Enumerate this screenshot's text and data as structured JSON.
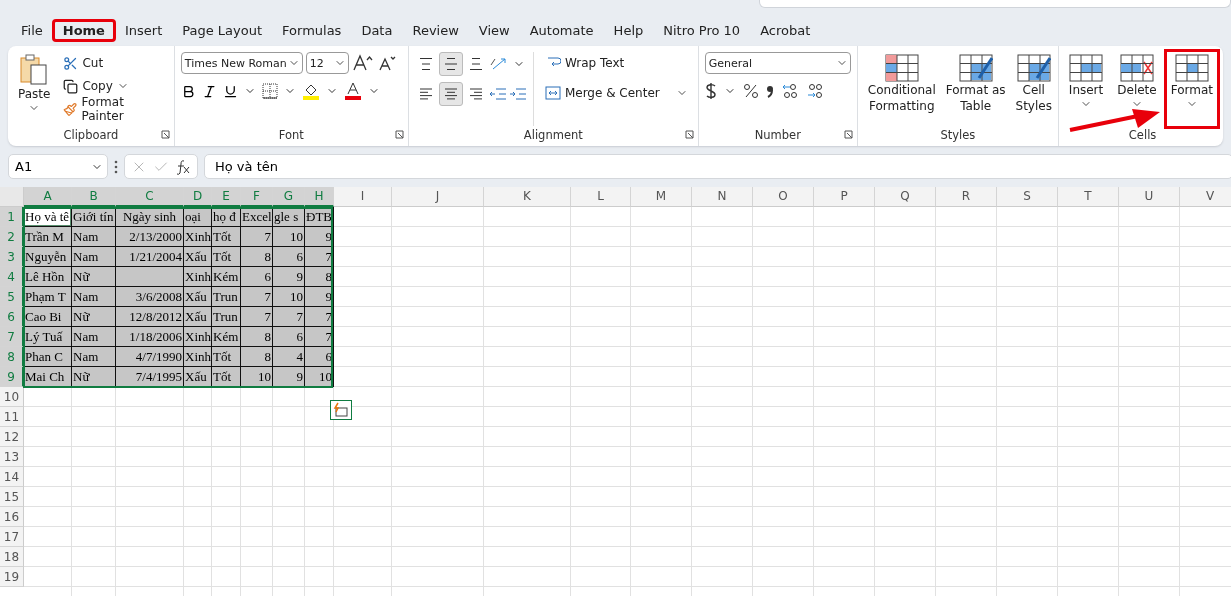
{
  "menu_tabs": [
    {
      "label": "File",
      "selected": false,
      "highlighted": false
    },
    {
      "label": "Home",
      "selected": true,
      "highlighted": true
    },
    {
      "label": "Insert",
      "selected": false,
      "highlighted": false
    },
    {
      "label": "Page Layout",
      "selected": false,
      "highlighted": false
    },
    {
      "label": "Formulas",
      "selected": false,
      "highlighted": false
    },
    {
      "label": "Data",
      "selected": false,
      "highlighted": false
    },
    {
      "label": "Review",
      "selected": false,
      "highlighted": false
    },
    {
      "label": "View",
      "selected": false,
      "highlighted": false
    },
    {
      "label": "Automate",
      "selected": false,
      "highlighted": false
    },
    {
      "label": "Help",
      "selected": false,
      "highlighted": false
    },
    {
      "label": "Nitro Pro 10",
      "selected": false,
      "highlighted": false
    },
    {
      "label": "Acrobat",
      "selected": false,
      "highlighted": false
    }
  ],
  "clipboard": {
    "paste": "Paste",
    "cut": "Cut",
    "copy": "Copy",
    "format_painter": "Format Painter",
    "label": "Clipboard"
  },
  "font": {
    "name": "Times New Roman",
    "size": "12",
    "label": "Font"
  },
  "alignment": {
    "vertical": [
      {
        "selected": false
      },
      {
        "selected": true
      },
      {
        "selected": false
      }
    ],
    "horizontal": [
      {
        "selected": false
      },
      {
        "selected": true
      },
      {
        "selected": false
      }
    ],
    "wrap_text": "Wrap Text",
    "merge": "Merge & Center",
    "label": "Alignment"
  },
  "number": {
    "format": "General",
    "label": "Number"
  },
  "styles": {
    "items": [
      "Conditional\nFormatting",
      "Format as\nTable",
      "Cell\nStyles"
    ],
    "label": "Styles"
  },
  "cells": {
    "items": [
      {
        "label": "Insert",
        "kind": "insert",
        "highlighted": false
      },
      {
        "label": "Delete",
        "kind": "delete",
        "highlighted": false
      },
      {
        "label": "Format",
        "kind": "format",
        "highlighted": true
      }
    ],
    "label": "Cells"
  },
  "formula_bar": {
    "name_box": "A1",
    "formula": "Họ và tên"
  },
  "sheet": {
    "columns": [
      {
        "letter": "A",
        "selected": true
      },
      {
        "letter": "B",
        "selected": true
      },
      {
        "letter": "C",
        "selected": true
      },
      {
        "letter": "D",
        "selected": true
      },
      {
        "letter": "E",
        "selected": true
      },
      {
        "letter": "F",
        "selected": true
      },
      {
        "letter": "G",
        "selected": true
      },
      {
        "letter": "H",
        "selected": true
      },
      {
        "letter": "I",
        "selected": false
      },
      {
        "letter": "J",
        "selected": false
      },
      {
        "letter": "K",
        "selected": false
      },
      {
        "letter": "L",
        "selected": false
      },
      {
        "letter": "M",
        "selected": false
      },
      {
        "letter": "N",
        "selected": false
      },
      {
        "letter": "O",
        "selected": false
      },
      {
        "letter": "P",
        "selected": false
      },
      {
        "letter": "Q",
        "selected": false
      },
      {
        "letter": "R",
        "selected": false
      },
      {
        "letter": "S",
        "selected": false
      },
      {
        "letter": "T",
        "selected": false
      },
      {
        "letter": "U",
        "selected": false
      },
      {
        "letter": "V",
        "selected": false
      }
    ],
    "rows": [
      {
        "number": "1",
        "selected": true,
        "cells": [
          {
            "text": "Họ và tê",
            "kind": "text",
            "active": true
          },
          {
            "text": "Giới tín",
            "kind": "text",
            "active": false
          },
          {
            "text": "Ngày sinh",
            "kind": "center",
            "active": false
          },
          {
            "text": "oại",
            "kind": "text",
            "active": false
          },
          {
            "text": "họ đ",
            "kind": "text",
            "active": false
          },
          {
            "text": "Excel",
            "kind": "text",
            "active": false
          },
          {
            "text": "gle s",
            "kind": "text",
            "active": false
          },
          {
            "text": "ĐTB",
            "kind": "text",
            "active": false
          }
        ]
      },
      {
        "number": "2",
        "selected": true,
        "cells": [
          {
            "text": "Trần M",
            "kind": "text",
            "active": false
          },
          {
            "text": "Nam",
            "kind": "text",
            "active": false
          },
          {
            "text": "2/13/2000",
            "kind": "number",
            "active": false
          },
          {
            "text": "Xinh",
            "kind": "text",
            "active": false
          },
          {
            "text": "Tốt",
            "kind": "text",
            "active": false
          },
          {
            "text": "7",
            "kind": "number",
            "active": false
          },
          {
            "text": "10",
            "kind": "number",
            "active": false
          },
          {
            "text": "9",
            "kind": "number",
            "active": false
          }
        ]
      },
      {
        "number": "3",
        "selected": true,
        "cells": [
          {
            "text": "Nguyễn",
            "kind": "text",
            "active": false
          },
          {
            "text": "Nam",
            "kind": "text",
            "active": false
          },
          {
            "text": "1/21/2004",
            "kind": "number",
            "active": false
          },
          {
            "text": "Xấu",
            "kind": "text",
            "active": false
          },
          {
            "text": "Tốt",
            "kind": "text",
            "active": false
          },
          {
            "text": "8",
            "kind": "number",
            "active": false
          },
          {
            "text": "6",
            "kind": "number",
            "active": false
          },
          {
            "text": "7",
            "kind": "number",
            "active": false
          }
        ]
      },
      {
        "number": "4",
        "selected": true,
        "cells": [
          {
            "text": "Lê Hồn",
            "kind": "text",
            "active": false
          },
          {
            "text": "Nữ",
            "kind": "text",
            "active": false
          },
          {
            "kind": "number",
            "active": false
          },
          {
            "text": "Xinh",
            "kind": "text",
            "active": false
          },
          {
            "text": "Kém",
            "kind": "text",
            "active": false
          },
          {
            "text": "6",
            "kind": "number",
            "active": false
          },
          {
            "text": "9",
            "kind": "number",
            "active": false
          },
          {
            "text": "8",
            "kind": "number",
            "active": false
          }
        ]
      },
      {
        "number": "5",
        "selected": true,
        "cells": [
          {
            "text": "Phạm T",
            "kind": "text",
            "active": false
          },
          {
            "text": "Nam",
            "kind": "text",
            "active": false
          },
          {
            "text": "3/6/2008",
            "kind": "number",
            "active": false
          },
          {
            "text": "Xấu",
            "kind": "text",
            "active": false
          },
          {
            "text": "Trun",
            "kind": "text",
            "active": false
          },
          {
            "text": "7",
            "kind": "number",
            "active": false
          },
          {
            "text": "10",
            "kind": "number",
            "active": false
          },
          {
            "text": "9",
            "kind": "number",
            "active": false
          }
        ]
      },
      {
        "number": "6",
        "selected": true,
        "cells": [
          {
            "text": "Cao Bi",
            "kind": "text",
            "active": false
          },
          {
            "text": "Nữ",
            "kind": "text",
            "active": false
          },
          {
            "text": "12/8/2012",
            "kind": "number",
            "active": false
          },
          {
            "text": "Xấu",
            "kind": "text",
            "active": false
          },
          {
            "text": "Trun",
            "kind": "text",
            "active": false
          },
          {
            "text": "7",
            "kind": "number",
            "active": false
          },
          {
            "text": "7",
            "kind": "number",
            "active": false
          },
          {
            "text": "7",
            "kind": "number",
            "active": false
          }
        ]
      },
      {
        "number": "7",
        "selected": true,
        "cells": [
          {
            "text": "Lý Tuấ",
            "kind": "text",
            "active": false
          },
          {
            "text": "Nam",
            "kind": "text",
            "active": false
          },
          {
            "text": "1/18/2006",
            "kind": "number",
            "active": false
          },
          {
            "text": "Xinh",
            "kind": "text",
            "active": false
          },
          {
            "text": "Kém",
            "kind": "text",
            "active": false
          },
          {
            "text": "8",
            "kind": "number",
            "active": false
          },
          {
            "text": "6",
            "kind": "number",
            "active": false
          },
          {
            "text": "7",
            "kind": "number",
            "active": false
          }
        ]
      },
      {
        "number": "8",
        "selected": true,
        "cells": [
          {
            "text": "Phan C",
            "kind": "text",
            "active": false
          },
          {
            "text": "Nam",
            "kind": "text",
            "active": false
          },
          {
            "text": "4/7/1990",
            "kind": "number",
            "active": false
          },
          {
            "text": "Xinh",
            "kind": "text",
            "active": false
          },
          {
            "text": "Tốt",
            "kind": "text",
            "active": false
          },
          {
            "text": "8",
            "kind": "number",
            "active": false
          },
          {
            "text": "4",
            "kind": "number",
            "active": false
          },
          {
            "text": "6",
            "kind": "number",
            "active": false
          }
        ]
      },
      {
        "number": "9",
        "selected": true,
        "cells": [
          {
            "text": "Mai Ch",
            "kind": "text",
            "active": false
          },
          {
            "text": "Nữ",
            "kind": "text",
            "active": false
          },
          {
            "text": "7/4/1995",
            "kind": "number",
            "active": false
          },
          {
            "text": "Xấu",
            "kind": "text",
            "active": false
          },
          {
            "text": "Tốt",
            "kind": "text",
            "active": false
          },
          {
            "text": "10",
            "kind": "number",
            "active": false
          },
          {
            "text": "9",
            "kind": "number",
            "active": false
          },
          {
            "text": "10",
            "kind": "number",
            "active": false
          }
        ]
      },
      {
        "number": "10",
        "selected": false
      },
      {
        "number": "11",
        "selected": false
      },
      {
        "number": "12",
        "selected": false
      },
      {
        "number": "13",
        "selected": false
      },
      {
        "number": "14",
        "selected": false
      },
      {
        "number": "15",
        "selected": false
      },
      {
        "number": "16",
        "selected": false
      },
      {
        "number": "17",
        "selected": false
      },
      {
        "number": "18",
        "selected": false
      },
      {
        "number": "19",
        "selected": false
      }
    ]
  }
}
